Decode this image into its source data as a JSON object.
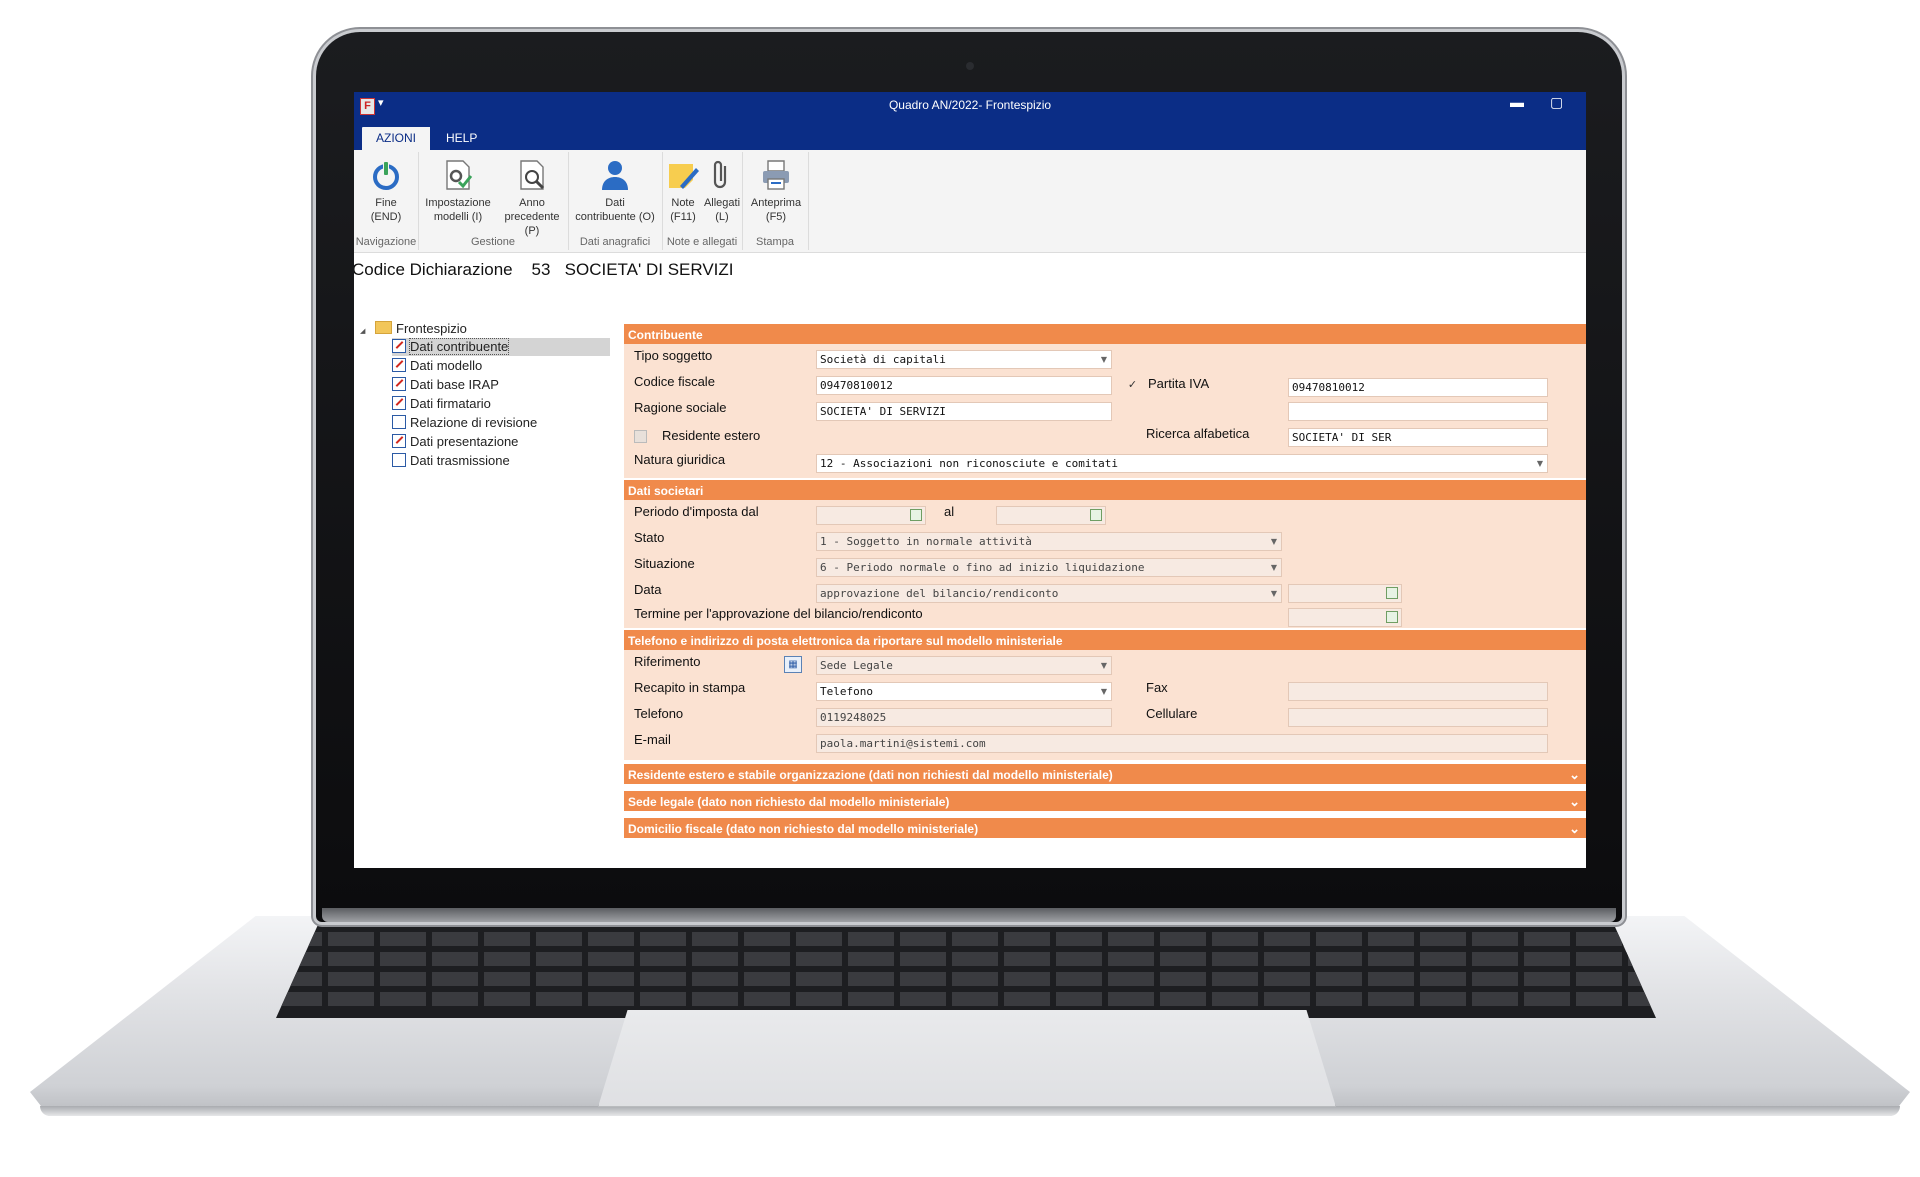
{
  "window": {
    "title": "Quadro AN/2022- Frontespizio",
    "app_icon": "F",
    "qat_glyph": "▾",
    "minimize_glyph": "▬",
    "maximize_glyph": "▢"
  },
  "ribbon_tabs": [
    {
      "label": "AZIONI",
      "active": true
    },
    {
      "label": "HELP",
      "active": false
    }
  ],
  "ribbon_groups": [
    {
      "label": "Navigazione",
      "buttons": [
        {
          "line1": "Fine",
          "line2": "(END)",
          "icon": "power-icon"
        }
      ]
    },
    {
      "label": "Gestione",
      "buttons": [
        {
          "line1": "Impostazione",
          "line2": "modelli (I)",
          "icon": "document-settings-icon"
        },
        {
          "line1": "Anno",
          "line2": "precedente (P)",
          "icon": "document-search-icon"
        }
      ]
    },
    {
      "label": "Dati anagrafici",
      "buttons": [
        {
          "line1": "Dati",
          "line2": "contribuente (O)",
          "icon": "person-icon"
        }
      ]
    },
    {
      "label": "Note e allegati",
      "buttons": [
        {
          "line1": "Note",
          "line2": "(F11)",
          "icon": "note-icon"
        },
        {
          "line1": "Allegati",
          "line2": "(L)",
          "icon": "paperclip-icon"
        }
      ]
    },
    {
      "label": "Stampa",
      "buttons": [
        {
          "line1": "Anteprima",
          "line2": "(F5)",
          "icon": "printer-icon"
        }
      ]
    }
  ],
  "header": {
    "label": "Codice Dichiarazione",
    "code": "53",
    "name": "SOCIETA' DI SERVIZI"
  },
  "tree": {
    "root": "Frontespizio",
    "expander": "◢",
    "items": [
      {
        "label": "Dati contribuente",
        "selected": true,
        "edited": true
      },
      {
        "label": "Dati modello",
        "selected": false,
        "edited": true
      },
      {
        "label": "Dati base IRAP",
        "selected": false,
        "edited": true
      },
      {
        "label": "Dati firmatario",
        "selected": false,
        "edited": true
      },
      {
        "label": "Relazione di revisione",
        "selected": false,
        "edited": false
      },
      {
        "label": "Dati presentazione",
        "selected": false,
        "edited": true
      },
      {
        "label": "Dati trasmissione",
        "selected": false,
        "edited": false
      }
    ]
  },
  "contribuente": {
    "title": "Contribuente",
    "tipo_soggetto_label": "Tipo soggetto",
    "tipo_soggetto_value": "Società di capitali",
    "codice_fiscale_label": "Codice fiscale",
    "codice_fiscale_value": "09470810012",
    "partita_iva_check": "✓",
    "partita_iva_label": "Partita IVA",
    "partita_iva_value": "09470810012",
    "ragione_sociale_label": "Ragione sociale",
    "ragione_sociale_value": "SOCIETA' DI SERVIZI",
    "ragione_sociale_extra": "",
    "residente_estero_label": "Residente estero",
    "ricerca_alfabetica_label": "Ricerca alfabetica",
    "ricerca_alfabetica_value": "SOCIETA' DI SER",
    "natura_giuridica_label": "Natura giuridica",
    "natura_giuridica_value": "12 - Associazioni non riconosciute e comitati"
  },
  "dati_societari": {
    "title": "Dati societari",
    "periodo_label": "Periodo d'imposta dal",
    "periodo_dal": "",
    "al_label": "al",
    "periodo_al": "",
    "stato_label": "Stato",
    "stato_value": "1 - Soggetto in normale attività",
    "situazione_label": "Situazione",
    "situazione_value": "6 - Periodo normale o fino ad inizio liquidazione",
    "data_label": "Data",
    "data_type": "approvazione del bilancio/rendiconto",
    "data_value": "",
    "termine_label": "Termine per l'approvazione del bilancio/rendiconto",
    "termine_value": ""
  },
  "telefono": {
    "title": "Telefono e indirizzo di posta elettronica da riportare sul modello ministeriale",
    "riferimento_label": "Riferimento",
    "riferimento_value": "Sede Legale",
    "recapito_label": "Recapito in stampa",
    "recapito_value": "Telefono",
    "fax_label": "Fax",
    "fax_value": "",
    "telefono_label": "Telefono",
    "telefono_value": "0119248025",
    "cellulare_label": "Cellulare",
    "cellulare_value": "",
    "email_label": "E-mail",
    "email_value": "paola.martini@sistemi.com"
  },
  "collapsed_sections": [
    {
      "title": "Residente estero e stabile organizzazione (dati non richiesti dal modello ministeriale)"
    },
    {
      "title": "Sede legale (dato non richiesto dal modello ministeriale)"
    },
    {
      "title": "Domicilio fiscale (dato non richiesto dal modello ministeriale)"
    }
  ],
  "colors": {
    "titlebar": "#0b2d86",
    "section_header": "#f08a4b",
    "section_body": "#fbe2d2"
  }
}
